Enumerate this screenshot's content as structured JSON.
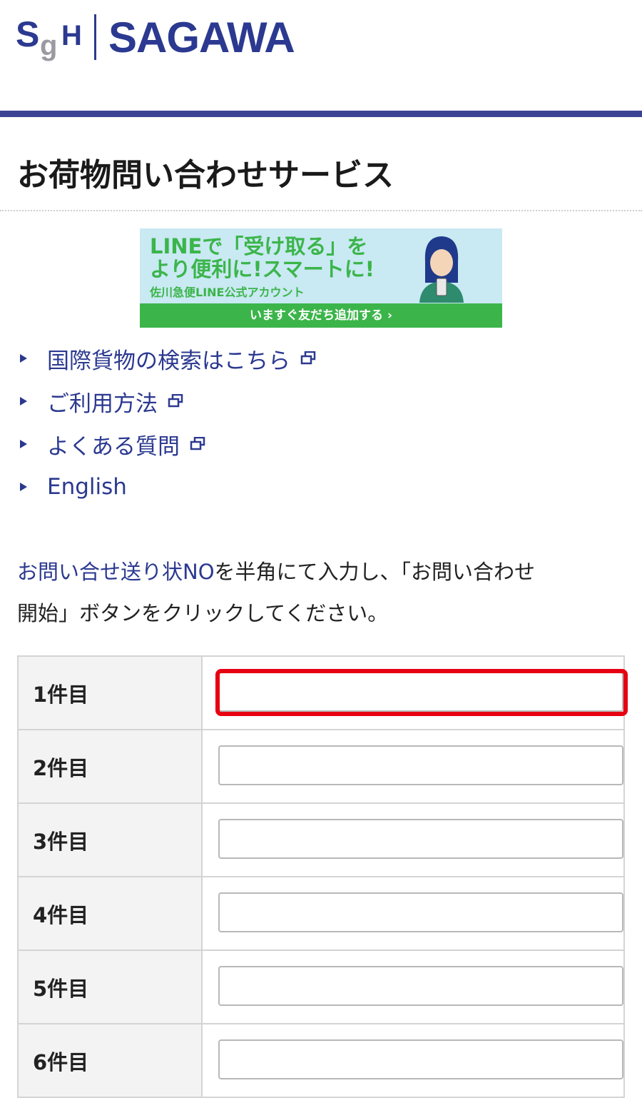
{
  "header": {
    "logo_sgh": {
      "s": "S",
      "g": "g",
      "h": "H"
    },
    "logo_sagawa": "SAGAWA",
    "accent_color": "#2b3990"
  },
  "page_title": "お荷物問い合わせサービス",
  "banner": {
    "line1": "LINEで「受け取る」を",
    "line2": "より便利に!スマートに!",
    "line3": "佐川急便LINE公式アカウント",
    "cta": "いますぐ友だち追加する ›",
    "bg_color": "#c9e9f3",
    "accent_color": "#3bb54a"
  },
  "links": [
    {
      "label": "国際貨物の検索はこちら",
      "icon": "external-window-icon"
    },
    {
      "label": "ご利用方法",
      "icon": "external-window-icon"
    },
    {
      "label": "よくある質問",
      "icon": "external-window-icon"
    },
    {
      "label": "English",
      "icon": ""
    }
  ],
  "instructions": {
    "highlight": "お問い合せ送り状NO",
    "rest_line1": "を半角にて入力し、「お問い合わせ",
    "rest_line2": "開始」ボタンをクリックしてください。"
  },
  "tracking_rows": [
    {
      "label": "1件目",
      "value": "",
      "highlighted": true
    },
    {
      "label": "2件目",
      "value": ""
    },
    {
      "label": "3件目",
      "value": ""
    },
    {
      "label": "4件目",
      "value": ""
    },
    {
      "label": "5件目",
      "value": ""
    },
    {
      "label": "6件目",
      "value": ""
    }
  ],
  "highlight_color": "#e60012"
}
